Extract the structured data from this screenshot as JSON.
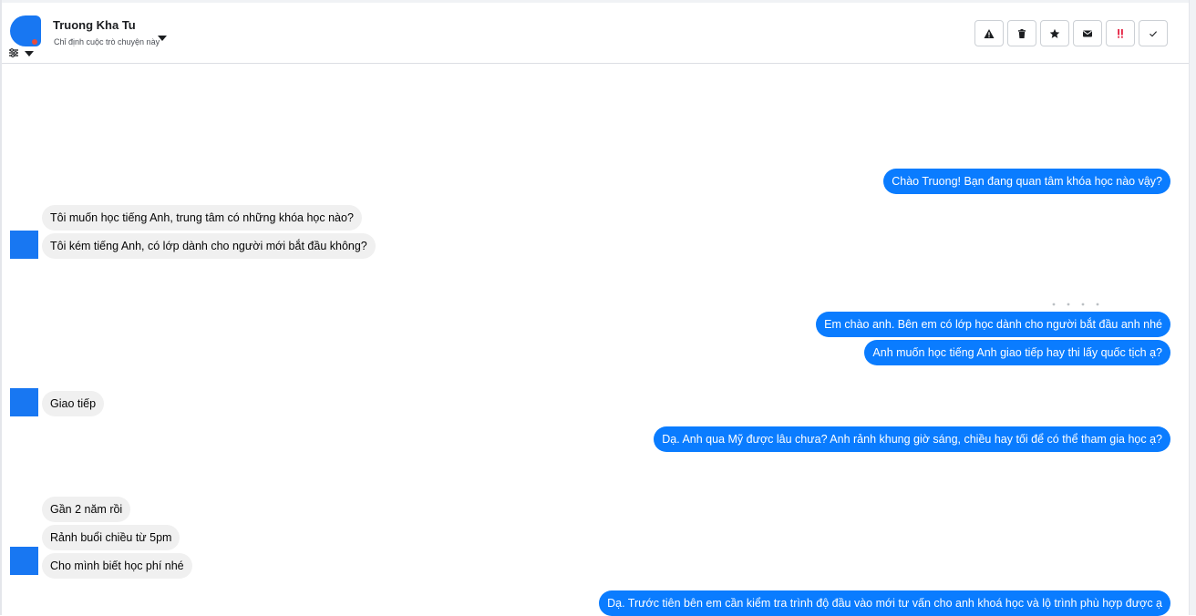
{
  "header": {
    "contact_name": "Truong Kha Tu",
    "assign_label": "Chỉ định cuộc trò chuyện này",
    "icons": {
      "avatar": "avatar",
      "filter": "sliders-icon",
      "assign_dropdown": "caret-down-icon"
    },
    "actions": [
      {
        "name": "warning-button",
        "icon": "warning-icon"
      },
      {
        "name": "delete-button",
        "icon": "trash-icon"
      },
      {
        "name": "star-button",
        "icon": "star-icon"
      },
      {
        "name": "mark-unread-button",
        "icon": "envelope-icon"
      },
      {
        "name": "priority-button",
        "icon": "exclamation-icon"
      },
      {
        "name": "done-button",
        "icon": "check-icon"
      }
    ]
  },
  "messages": [
    {
      "from": "page",
      "text": "Chào Truong! Bạn đang quan tâm khóa học nào vậy?"
    },
    {
      "from": "user",
      "text": "Tôi muốn học tiếng Anh, trung tâm có những khóa học nào?"
    },
    {
      "from": "user",
      "text": "Tôi kém tiếng Anh, có lớp dành cho người mới bắt đầu không?"
    },
    {
      "from": "page",
      "text": "Em chào anh. Bên em có lớp học dành cho người bắt đầu anh nhé"
    },
    {
      "from": "page",
      "text": "Anh muốn học tiếng Anh giao tiếp hay thi lấy quốc tịch ạ?"
    },
    {
      "from": "user",
      "text": "Giao tiếp"
    },
    {
      "from": "page",
      "text": "Dạ. Anh qua Mỹ được lâu chưa? Anh rảnh khung giờ sáng, chiều hay tối để có thể tham gia học ạ?"
    },
    {
      "from": "user",
      "text": "Gần 2 năm rồi"
    },
    {
      "from": "user",
      "text": "Rảnh buổi chiều từ 5pm"
    },
    {
      "from": "user",
      "text": "Cho mình biết học phí nhé"
    },
    {
      "from": "page",
      "text": "Dạ. Trước tiên bên em cần kiểm tra trình độ đầu vào mới tư vấn cho anh khoá học và lộ trình phù hợp được ạ"
    }
  ],
  "colors": {
    "outgoing_bubble": "#0a7cff",
    "incoming_bubble": "#f0f0f0",
    "avatar": "#1877f2",
    "priority_icon": "#e41e3f"
  }
}
